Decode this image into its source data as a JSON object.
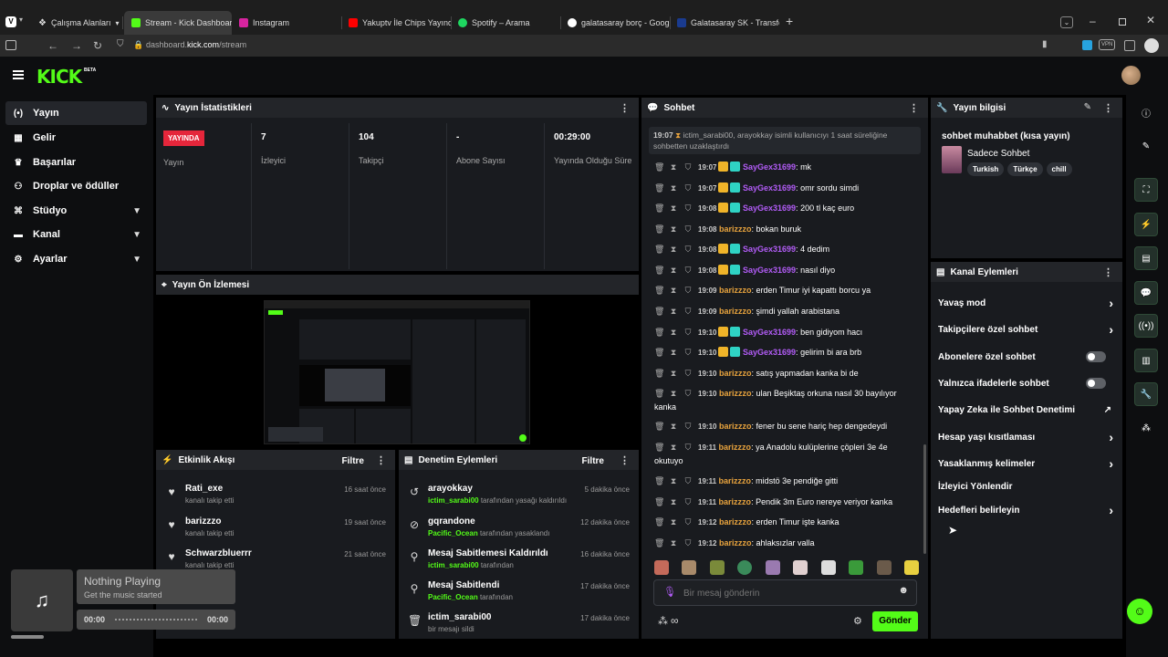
{
  "browser": {
    "workspaces": "Çalışma Alanları",
    "tabs": [
      {
        "title": "Stream - Kick Dashboard",
        "color": "#53fc18"
      },
      {
        "title": "Instagram",
        "color": "#d6249f"
      },
      {
        "title": "Yakuptv İle Chips Yayında K",
        "color": "#ff0000"
      },
      {
        "title": "Spotify – Arama",
        "color": "#1ed760"
      },
      {
        "title": "galatasaray borç - Google'",
        "color": "#ffffff"
      },
      {
        "title": "Galatasaray SK - Transferle",
        "color": "#1a3b8f"
      }
    ],
    "url_prefix": "dashboard.",
    "url_domain": "kick.com",
    "url_path": "/stream",
    "vpn": "VPN"
  },
  "brand": {
    "logo": "KICK",
    "beta": "BETA",
    "color": "#53fc18"
  },
  "sidebar": {
    "items": [
      {
        "label": "Yayın",
        "icon": "stream-icon"
      },
      {
        "label": "Gelir",
        "icon": "revenue-icon"
      },
      {
        "label": "Başarılar",
        "icon": "trophy-icon"
      },
      {
        "label": "Droplar ve ödüller",
        "icon": "gift-icon"
      },
      {
        "label": "Stüdyo",
        "icon": "studio-icon"
      },
      {
        "label": "Kanal",
        "icon": "channel-icon"
      },
      {
        "label": "Ayarlar",
        "icon": "settings-icon"
      }
    ]
  },
  "stats": {
    "title": "Yayın İstatistikleri",
    "live_badge": "YAYINDA",
    "status_label": "Yayın",
    "viewers": {
      "value": "7",
      "label": "İzleyici"
    },
    "followers": {
      "value": "104",
      "label": "Takipçi"
    },
    "subs": {
      "value": "-",
      "label": "Abone Sayısı"
    },
    "uptime": {
      "value": "00:29:00",
      "label": "Yayında Olduğu Süre"
    }
  },
  "preview": {
    "title": "Yayın Ön İzlemesi"
  },
  "activity": {
    "title": "Etkinlik Akışı",
    "filter": "Filtre",
    "items": [
      {
        "name": "Rati_exe",
        "sub": "kanalı takip etti",
        "time": "16 saat önce"
      },
      {
        "name": "barizzzo",
        "sub": "kanalı takip etti",
        "time": "19 saat önce"
      },
      {
        "name": "Schwarzbluerrr",
        "sub": "kanalı takip etti",
        "time": "21 saat önce"
      }
    ]
  },
  "moderation": {
    "title": "Denetim Eylemleri",
    "filter": "Filtre",
    "items": [
      {
        "name": "arayokkay",
        "actor": "ictim_sarabi00",
        "sub": "tarafından yasağı kaldırıldı",
        "time": "5 dakika önce",
        "icon": "unban-icon"
      },
      {
        "name": "gqrandone",
        "actor": "Pacific_Ocean",
        "sub": "tarafından yasaklandı",
        "time": "12 dakika önce",
        "icon": "ban-icon"
      },
      {
        "name": "Mesaj Sabitlemesi Kaldırıldı",
        "actor": "ictim_sarabi00",
        "sub": "tarafından",
        "time": "16 dakika önce",
        "icon": "unpin-icon"
      },
      {
        "name": "Mesaj Sabitlendi",
        "actor": "Pacific_Ocean",
        "sub": "tarafından",
        "time": "17 dakika önce",
        "icon": "pin-icon"
      },
      {
        "name": "ictim_sarabi00",
        "actor": "",
        "sub": "bir mesajı sildi",
        "time": "17 dakika önce",
        "icon": "trash-icon"
      }
    ]
  },
  "player": {
    "title": "Nothing Playing",
    "subtitle": "Get the music started",
    "start": "00:00",
    "end": "00:00"
  },
  "chat": {
    "title": "Sohbet",
    "system_time": "19:07",
    "system_text": "ictim_sarabi00, arayokkay isimli kullanıcıyı 1 saat süreliğine sohbetten uzaklaştırdı",
    "messages": [
      {
        "time": "19:07",
        "user": "SayGex31699",
        "color": "#b25cf7",
        "badges": true,
        "text": "mk"
      },
      {
        "time": "19:07",
        "user": "SayGex31699",
        "color": "#b25cf7",
        "badges": true,
        "text": "omr sordu simdi"
      },
      {
        "time": "19:08",
        "user": "SayGex31699",
        "color": "#b25cf7",
        "badges": true,
        "text": "200 tl kaç euro"
      },
      {
        "time": "19:08",
        "user": "barizzzo",
        "color": "#e8a33d",
        "badges": false,
        "text": "bokan buruk"
      },
      {
        "time": "19:08",
        "user": "SayGex31699",
        "color": "#b25cf7",
        "badges": true,
        "text": "4 dedim"
      },
      {
        "time": "19:08",
        "user": "SayGex31699",
        "color": "#b25cf7",
        "badges": true,
        "text": "nasıl diyo"
      },
      {
        "time": "19:09",
        "user": "barizzzo",
        "color": "#e8a33d",
        "badges": false,
        "text": "erden Timur iyi kapattı borcu ya"
      },
      {
        "time": "19:09",
        "user": "barizzzo",
        "color": "#e8a33d",
        "badges": false,
        "text": "şimdi yallah arabistana"
      },
      {
        "time": "19:10",
        "user": "SayGex31699",
        "color": "#b25cf7",
        "badges": true,
        "text": "ben gidiyom hacı"
      },
      {
        "time": "19:10",
        "user": "SayGex31699",
        "color": "#b25cf7",
        "badges": true,
        "text": "gelirim bi ara brb"
      },
      {
        "time": "19:10",
        "user": "barizzzo",
        "color": "#e8a33d",
        "badges": false,
        "text": "satış yapmadan kanka bi de"
      },
      {
        "time": "19:10",
        "user": "barizzzo",
        "color": "#e8a33d",
        "badges": false,
        "text": "ulan Beşiktaş orkuna nasıl 30 bayılıyor kanka"
      },
      {
        "time": "19:10",
        "user": "barizzzo",
        "color": "#e8a33d",
        "badges": false,
        "text": "fener bu sene hariç hep dengedeydi"
      },
      {
        "time": "19:11",
        "user": "barizzzo",
        "color": "#e8a33d",
        "badges": false,
        "text": "ya Anadolu kulüplerine çöpleri 3e 4e okutuyo"
      },
      {
        "time": "19:11",
        "user": "barizzzo",
        "color": "#e8a33d",
        "badges": false,
        "text": "midstö 3e pendiğe gitti"
      },
      {
        "time": "19:11",
        "user": "barizzzo",
        "color": "#e8a33d",
        "badges": false,
        "text": "Pendik 3m Euro nereye veriyor kanka"
      },
      {
        "time": "19:12",
        "user": "barizzzo",
        "color": "#e8a33d",
        "badges": false,
        "text": "erden Timur işte kanka"
      },
      {
        "time": "19:12",
        "user": "barizzzo",
        "color": "#e8a33d",
        "badges": false,
        "text": "ahlaksızlar valla"
      }
    ],
    "placeholder": "Bir mesaj gönderin",
    "send": "Gönder"
  },
  "stream_info": {
    "title": "Yayın bilgisi",
    "stream_title": "sohbet muhabbet (kısa yayın)",
    "category": "Sadece Sohbet",
    "tags": [
      "Turkish",
      "Türkçe",
      "chill"
    ]
  },
  "channel_actions": {
    "title": "Kanal Eylemleri",
    "items": [
      {
        "label": "Yavaş mod",
        "control": "chevron"
      },
      {
        "label": "Takipçilere özel sohbet",
        "control": "chevron"
      },
      {
        "label": "Abonelere özel sohbet",
        "control": "toggle"
      },
      {
        "label": "Yalnızca ifadelerle sohbet",
        "control": "toggle"
      },
      {
        "label": "Yapay Zeka ile Sohbet Denetimi",
        "control": "external"
      },
      {
        "label": "Hesap yaşı kısıtlaması",
        "control": "chevron"
      },
      {
        "label": "Yasaklanmış kelimeler",
        "control": "chevron"
      },
      {
        "label": "İzleyici Yönlendir",
        "control": "none"
      },
      {
        "label": "Hedefleri belirleyin",
        "control": "chevron"
      }
    ]
  }
}
